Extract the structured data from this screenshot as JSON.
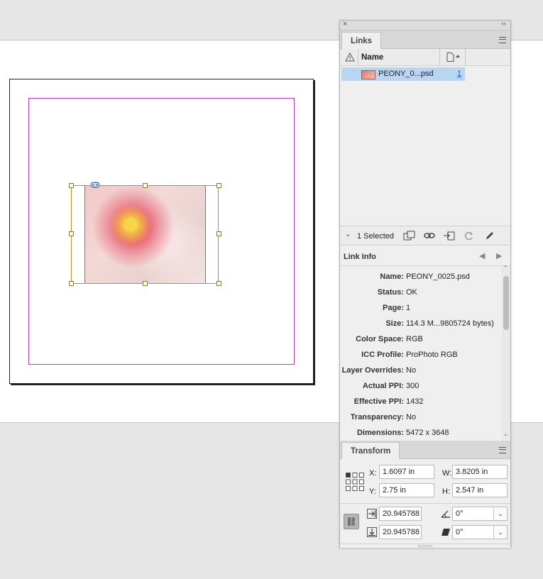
{
  "links_panel": {
    "tab_label": "Links",
    "column_name": "Name",
    "items": [
      {
        "name": "PEONY_0...psd",
        "page": "1"
      }
    ],
    "selected_count": "1 Selected"
  },
  "link_info": {
    "title": "Link Info",
    "rows": [
      {
        "label": "Name:",
        "value": "PEONY_0025.psd"
      },
      {
        "label": "Status:",
        "value": "OK"
      },
      {
        "label": "Page:",
        "value": "1"
      },
      {
        "label": "Size:",
        "value": "114.3 M...9805724 bytes)"
      },
      {
        "label": "Color Space:",
        "value": "RGB"
      },
      {
        "label": "ICC Profile:",
        "value": "ProPhoto RGB"
      },
      {
        "label": "Layer Overrides:",
        "value": "No"
      },
      {
        "label": "Actual PPI:",
        "value": "300"
      },
      {
        "label": "Effective PPI:",
        "value": "1432"
      },
      {
        "label": "Transparency:",
        "value": "No"
      },
      {
        "label": "Dimensions:",
        "value": "5472 x 3648"
      }
    ]
  },
  "transform_panel": {
    "tab_label": "Transform",
    "x_label": "X:",
    "x_value": "1.6097 in",
    "y_label": "Y:",
    "y_value": "2.75 in",
    "w_label": "W:",
    "w_value": "3.8205 in",
    "h_label": "H:",
    "h_value": "2.547 in",
    "scale_x_value": "20.945788",
    "scale_y_value": "20.945788",
    "rotate_value": "0°",
    "shear_value": "0°"
  },
  "colors": {
    "margin_guide": "#c43ec8",
    "frame_border": "#b5951b",
    "selection_highlight": "#b8d5f3"
  }
}
